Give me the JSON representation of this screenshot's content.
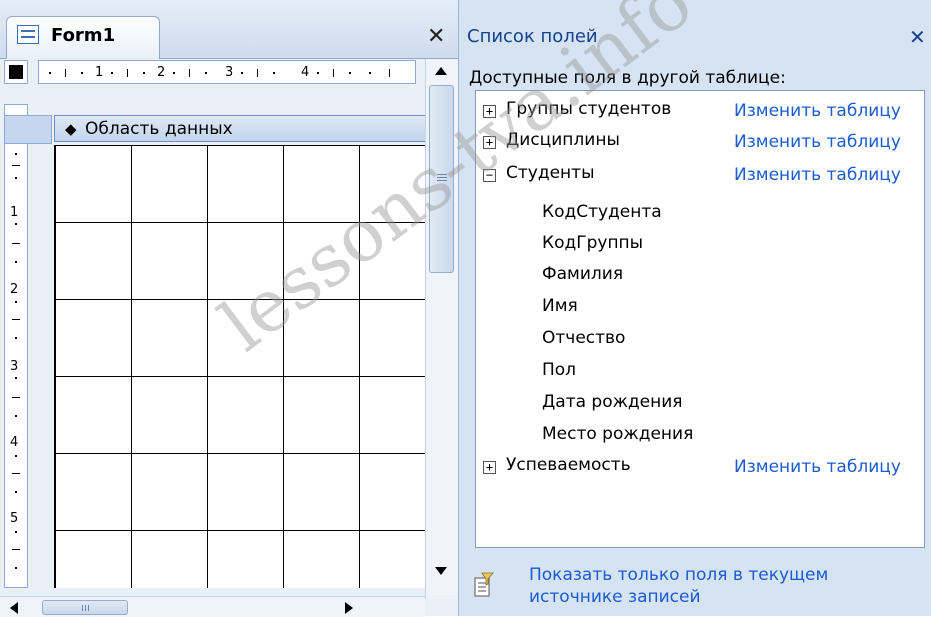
{
  "form_tab": {
    "title": "Form1",
    "close_symbol": "✕"
  },
  "ruler": {
    "h_numbers": [
      "1",
      "2",
      "3",
      "4"
    ],
    "v_numbers": [
      "1",
      "2",
      "3",
      "4",
      "5"
    ]
  },
  "section": {
    "arrow": "◆",
    "label": "Область данных"
  },
  "field_list": {
    "title": "Список полей",
    "close_symbol": "✕",
    "subtitle": "Доступные поля в другой таблице:",
    "tables": [
      {
        "toggle": "+",
        "name": "Группы студентов",
        "link": "Изменить таблицу",
        "fields": []
      },
      {
        "toggle": "+",
        "name": "Дисциплины",
        "link": "Изменить таблицу",
        "fields": []
      },
      {
        "toggle": "−",
        "name": "Студенты",
        "link": "Изменить таблицу",
        "fields": [
          "КодСтудента",
          "КодГруппы",
          "Фамилия",
          "Имя",
          "Отчество",
          "Пол",
          "Дата рождения",
          "Место рождения"
        ]
      },
      {
        "toggle": "+",
        "name": "Успеваемость",
        "link": "Изменить таблицу",
        "fields": []
      }
    ],
    "footer_line1": "Показать только поля в текущем",
    "footer_line2": "источнике записей"
  },
  "watermark": "lessons-tva.info"
}
